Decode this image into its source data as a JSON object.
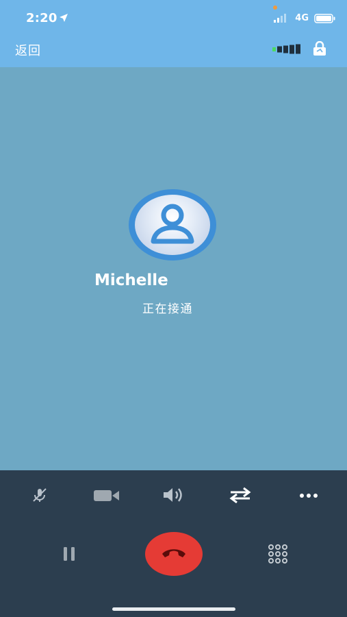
{
  "status_bar": {
    "time": "2:20",
    "network": "4G",
    "icons": [
      "location-arrow-icon",
      "signal-icon",
      "battery-icon"
    ]
  },
  "nav": {
    "back_label": "返回",
    "icons": [
      "call-quality-icon",
      "encryption-icon"
    ]
  },
  "call": {
    "contact_name": "Michelle",
    "status": "正在接通"
  },
  "controls": {
    "row1": [
      "mute-icon",
      "video-icon",
      "speaker-icon",
      "transfer-icon",
      "more-icon"
    ],
    "row2": [
      "hold-icon",
      "end-call-icon",
      "keypad-icon"
    ]
  },
  "colors": {
    "header": "#6fb6e9",
    "background": "#6ea8c4",
    "controls": "#2c3e4f",
    "end_call": "#e53b35",
    "avatar_ring": "#3e8fd7"
  }
}
